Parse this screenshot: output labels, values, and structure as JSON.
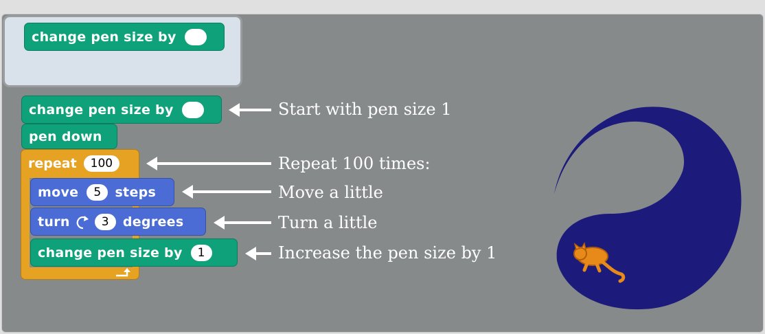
{
  "palette": {
    "block_label": "change pen size by",
    "block_value": ""
  },
  "script": {
    "change_pen_size_1": {
      "label": "change pen size by",
      "value": ""
    },
    "pen_down": {
      "label": "pen down"
    },
    "repeat": {
      "label": "repeat",
      "value": "100"
    },
    "move": {
      "label_before": "move",
      "value": "5",
      "label_after": "steps"
    },
    "turn": {
      "label_before": "turn",
      "icon": "rotate-clockwise-icon",
      "value": "3",
      "label_after": "degrees"
    },
    "change_pen_size_2": {
      "label": "change pen size by",
      "value": "1"
    }
  },
  "notes": {
    "start": "Start with pen size 1",
    "repeat": "Repeat 100 times:",
    "move": "Move a little",
    "turn": "Turn a little",
    "increase": "Increase the pen size by 1"
  },
  "colors": {
    "pen": "#0fa17a",
    "motion": "#4a6cd4",
    "control": "#e6a223",
    "stage_drawing": "#1c1a7a",
    "sprite": "#e88a1a"
  }
}
